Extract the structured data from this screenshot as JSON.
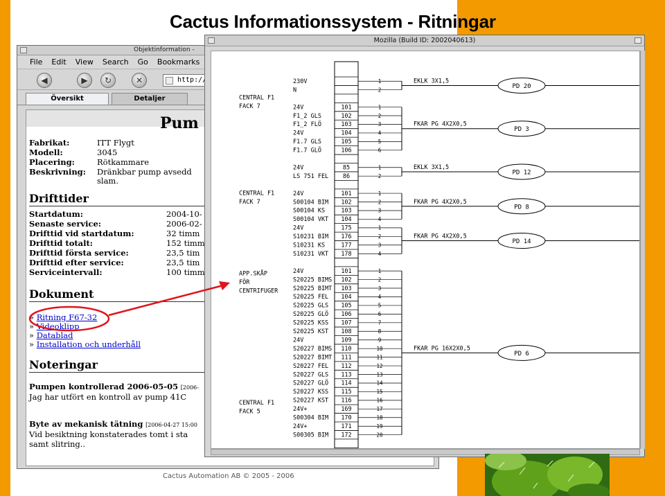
{
  "slide": {
    "title": "Cactus Informationssystem - Ritningar",
    "footer": "Cactus Automation AB © 2005 - 2006",
    "accent_color": "#f29a00"
  },
  "browser": {
    "title": "Objektinformation -",
    "menu": [
      "File",
      "Edit",
      "View",
      "Search",
      "Go",
      "Bookmarks"
    ],
    "toolbar_icons": [
      "back-icon",
      "forward-icon",
      "reload-icon",
      "stop-icon"
    ],
    "url": "http://",
    "tabs": [
      "Översikt",
      "Detaljer"
    ],
    "heading": "Pum",
    "info": [
      {
        "label": "Fabrikat:",
        "value": "ITT Flygt"
      },
      {
        "label": "Modell:",
        "value": "3045"
      },
      {
        "label": "Placering:",
        "value": "Rötkammare"
      },
      {
        "label": "Beskrivning:",
        "value": "Dränkbar pump avsedd"
      },
      {
        "label": "",
        "value": "slam."
      }
    ],
    "drift_heading": "Drifttider",
    "drift": [
      {
        "label": "Startdatum:",
        "value": "2004-10-"
      },
      {
        "label": "Senaste service:",
        "value": "2006-02-"
      },
      {
        "label": "Drifttid vid startdatum:",
        "value": "32 timm"
      },
      {
        "label": "Drifttid totalt:",
        "value": "152 timm"
      },
      {
        "label": "Drifttid första service:",
        "value": "23,5 tim"
      },
      {
        "label": "Drifttid efter service:",
        "value": "23,5 tim"
      },
      {
        "label": "Serviceintervall:",
        "value": "100 timm"
      }
    ],
    "doc_heading": "Dokument",
    "docs": [
      "Ritning F67-32",
      "Videoklipp",
      "Datablad",
      "Installation och underhåll"
    ],
    "doc_bullet": "»",
    "notes_heading": "Noteringar",
    "notes": [
      {
        "title": "Pumpen kontrollerad 2006-05-05",
        "meta": "[2006-",
        "body": [
          "Jag har utfört en kontroll av pump 41C"
        ]
      },
      {
        "title": "Byte av mekanisk tätning",
        "meta": "[2006-04-27 15:00",
        "body": [
          "Vid besiktning konstaterades tomt i sta",
          "samt slitring.."
        ]
      }
    ]
  },
  "drawing_window": {
    "title": "Mozilla (Build ID: 2002040613)",
    "groups": [
      {
        "lines": [
          "CENTRAL F1",
          "FACK 7"
        ]
      },
      {
        "lines": [
          "CENTRAL F1",
          "FACK 7"
        ]
      },
      {
        "lines": [
          "APP.SKÅP",
          "FÖR",
          "CENTRIFUGER"
        ]
      },
      {
        "lines": [
          "CENTRAL F1",
          "FACK 5"
        ]
      }
    ],
    "terminals": [
      {
        "sig": "230V",
        "num": "",
        "pin": "1"
      },
      {
        "sig": "N",
        "num": "",
        "pin": "2"
      },
      {
        "sig": "",
        "num": "",
        "pin": ""
      },
      {
        "sig": "24V",
        "num": "101",
        "pin": "1"
      },
      {
        "sig": "F1_2 GLS",
        "num": "102",
        "pin": "2"
      },
      {
        "sig": "F1_2 FLÖ",
        "num": "103",
        "pin": "3"
      },
      {
        "sig": "24V",
        "num": "104",
        "pin": "4"
      },
      {
        "sig": "F1.7 GLS",
        "num": "105",
        "pin": "5"
      },
      {
        "sig": "F1.7 GLÖ",
        "num": "106",
        "pin": "6"
      },
      {
        "sig": "",
        "num": "",
        "pin": ""
      },
      {
        "sig": "24V",
        "num": "85",
        "pin": "1"
      },
      {
        "sig": "LS 751 FEL",
        "num": "86",
        "pin": "2"
      },
      {
        "sig": "",
        "num": "",
        "pin": ""
      },
      {
        "sig": "24V",
        "num": "101",
        "pin": "1"
      },
      {
        "sig": "S00104 BIM",
        "num": "102",
        "pin": "2"
      },
      {
        "sig": "S00104 KS",
        "num": "103",
        "pin": "3"
      },
      {
        "sig": "S00104 VKT",
        "num": "104",
        "pin": "4"
      },
      {
        "sig": "24V",
        "num": "175",
        "pin": "1"
      },
      {
        "sig": "S10231 BIM",
        "num": "176",
        "pin": "2"
      },
      {
        "sig": "S10231 KS",
        "num": "177",
        "pin": "3"
      },
      {
        "sig": "S10231 VKT",
        "num": "178",
        "pin": "4"
      },
      {
        "sig": "",
        "num": "",
        "pin": ""
      },
      {
        "sig": "24V",
        "num": "101",
        "pin": "1"
      },
      {
        "sig": "S20225 BIMS",
        "num": "102",
        "pin": "2"
      },
      {
        "sig": "S20225 BIMT",
        "num": "103",
        "pin": "3"
      },
      {
        "sig": "S20225 FEL",
        "num": "104",
        "pin": "4"
      },
      {
        "sig": "S20225 GLS",
        "num": "105",
        "pin": "5"
      },
      {
        "sig": "S20225 GLÖ",
        "num": "106",
        "pin": "6"
      },
      {
        "sig": "S20225 KSS",
        "num": "107",
        "pin": "7"
      },
      {
        "sig": "S20225 KST",
        "num": "108",
        "pin": "8"
      },
      {
        "sig": "24V",
        "num": "109",
        "pin": "9"
      },
      {
        "sig": "S20227 BIMS",
        "num": "110",
        "pin": "10"
      },
      {
        "sig": "S20227 BIMT",
        "num": "111",
        "pin": "11"
      },
      {
        "sig": "S20227 FEL",
        "num": "112",
        "pin": "12"
      },
      {
        "sig": "S20227 GLS",
        "num": "113",
        "pin": "13"
      },
      {
        "sig": "S20227 GLÖ",
        "num": "114",
        "pin": "14"
      },
      {
        "sig": "S20227 KSS",
        "num": "115",
        "pin": "15"
      },
      {
        "sig": "S20227 KST",
        "num": "116",
        "pin": "16"
      },
      {
        "sig": "24V+",
        "num": "169",
        "pin": "17"
      },
      {
        "sig": "S00304 BIM",
        "num": "170",
        "pin": "18"
      },
      {
        "sig": "24V+",
        "num": "171",
        "pin": "19"
      },
      {
        "sig": "S00305 BIM",
        "num": "172",
        "pin": "20"
      },
      {
        "sig": "",
        "num": "",
        "pin": ""
      },
      {
        "sig": "",
        "num": "",
        "pin": ""
      }
    ],
    "cables": [
      {
        "cable": "EKLK 3X1,5",
        "dest": "PD 20",
        "first": 0,
        "last": 1
      },
      {
        "cable": "FKAR PG 4X2X0,5",
        "dest": "PD 3",
        "first": 3,
        "last": 8
      },
      {
        "cable": "EKLK 3X1,5",
        "dest": "PD 12",
        "first": 10,
        "last": 11
      },
      {
        "cable": "FKAR PG 4X2X0,5",
        "dest": "PD 8",
        "first": 13,
        "last": 16
      },
      {
        "cable": "FKAR PG 4X2X0,5",
        "dest": "PD 14",
        "first": 17,
        "last": 20
      },
      {
        "cable": "FKAR PG 16X2X0,5",
        "dest": "PD 6",
        "first": 22,
        "last": 41
      }
    ]
  }
}
